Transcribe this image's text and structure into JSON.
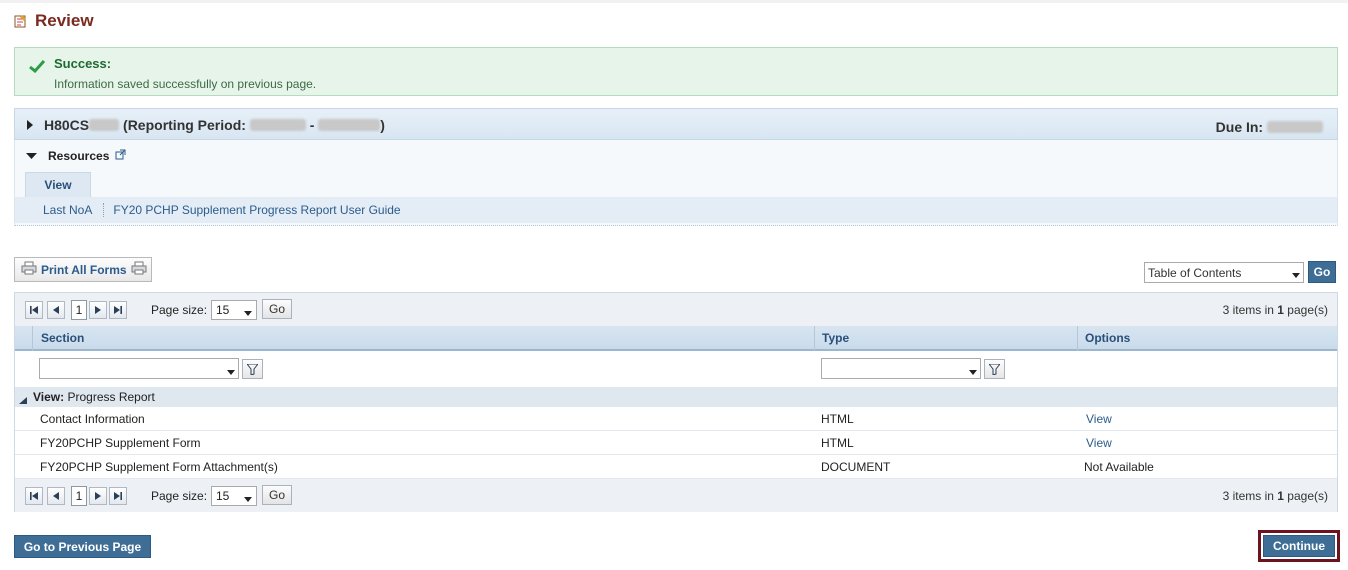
{
  "page": {
    "title": "Review",
    "icon": "review-edit-icon"
  },
  "success": {
    "title": "Success:",
    "message": "Information saved successfully on previous page.",
    "icon": "check-icon"
  },
  "grant": {
    "id_prefix": "H80CS",
    "period_label": "(Reporting Period:",
    "separator": "-",
    "close_paren": ")",
    "due_label": "Due In:"
  },
  "resources": {
    "label": "Resources",
    "tab": "View",
    "links": [
      "Last NoA",
      "FY20 PCHP Supplement Progress Report User Guide"
    ]
  },
  "toolbar": {
    "print_all": "Print All Forms",
    "toc_value": "Table of Contents",
    "go": "Go"
  },
  "pager": {
    "page": "1",
    "page_size_label": "Page size:",
    "page_size": "15",
    "go": "Go",
    "info_prefix": "3 items in ",
    "info_pages": "1",
    "info_suffix": " page(s)"
  },
  "grid": {
    "columns": [
      "Section",
      "Type",
      "Options"
    ],
    "group": {
      "prefix": "View:",
      "name": "Progress Report"
    },
    "rows": [
      {
        "section": "Contact Information",
        "type": "HTML",
        "options": "View"
      },
      {
        "section": "FY20PCHP Supplement Form",
        "type": "HTML",
        "options": "View"
      },
      {
        "section": "FY20PCHP Supplement Form Attachment(s)",
        "type": "DOCUMENT",
        "options": "Not Available"
      }
    ]
  },
  "footer": {
    "prev": "Go to Previous Page",
    "continue": "Continue"
  },
  "colors": {
    "accent": "#3e6d95",
    "title": "#7a2a1e",
    "success": "#1e6a31",
    "highlight": "#6d1320"
  }
}
